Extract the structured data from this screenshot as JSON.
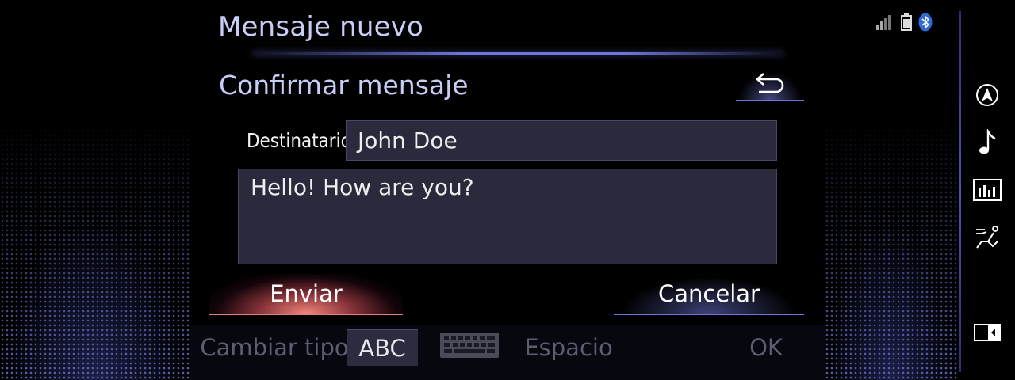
{
  "header": {
    "title": "Mensaje nuevo",
    "subtitle": "Confirmar mensaje"
  },
  "status_bar": {
    "icons": [
      "signal-strength-icon",
      "battery-icon",
      "bluetooth-icon"
    ]
  },
  "form": {
    "recipient_label": "Destinatario:",
    "recipient_value": "John Doe",
    "message_text": "Hello! How are you?"
  },
  "actions": {
    "send_label": "Enviar",
    "cancel_label": "Cancelar",
    "back_icon": "back-arrow-icon"
  },
  "keyboard_bar": {
    "change_type_label": "Cambiar tipo",
    "abc_label": "ABC",
    "keyboard_icon": "keyboard-icon",
    "space_label": "Espacio",
    "ok_label": "OK"
  },
  "sidebar": {
    "icons": [
      "navigation-icon",
      "music-note-icon",
      "equalizer-icon",
      "climate-seat-icon",
      "split-screen-icon"
    ]
  },
  "colors": {
    "title_text": "#c8cdf6",
    "accent_blue": "#6d76d6",
    "send_glow": "#e08080",
    "field_bg": "#2a2a3c",
    "inactive_text": "#5d5d70"
  }
}
